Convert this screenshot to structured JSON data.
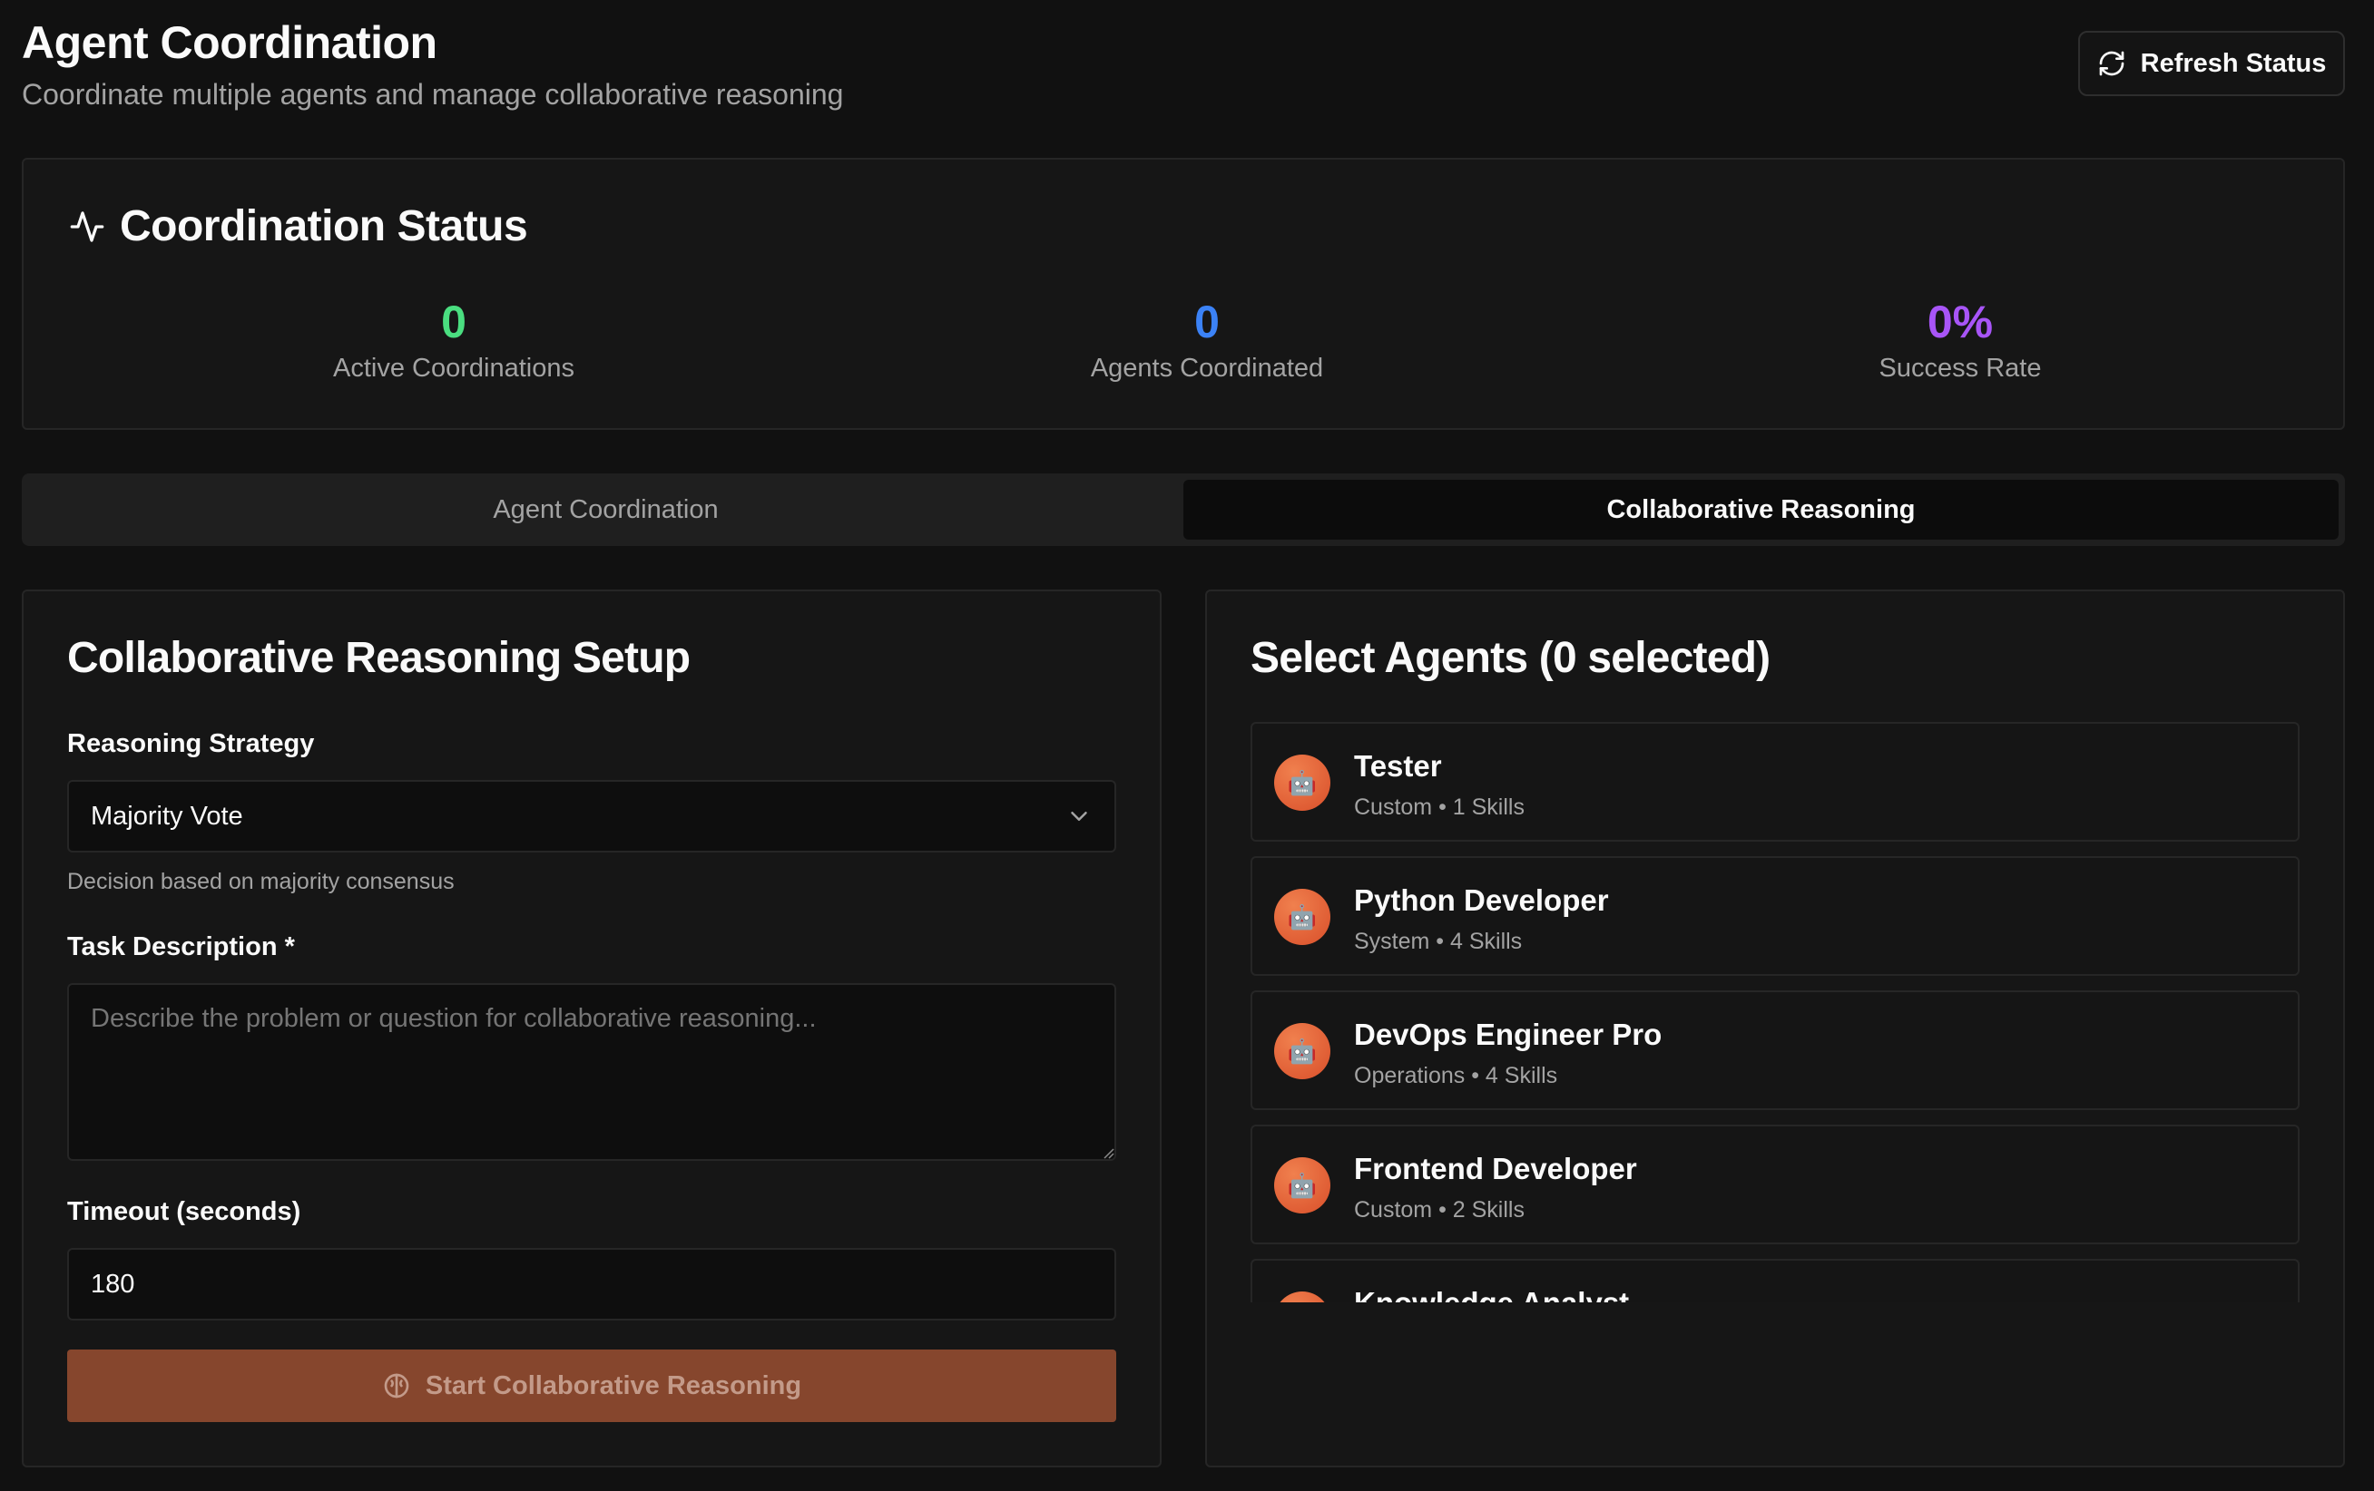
{
  "header": {
    "title": "Agent Coordination",
    "subtitle": "Coordinate multiple agents and manage collaborative reasoning",
    "refresh_label": "Refresh Status"
  },
  "status": {
    "title": "Coordination Status",
    "stats": [
      {
        "value": "0",
        "label": "Active Coordinations",
        "color": "#4ade80"
      },
      {
        "value": "0",
        "label": "Agents Coordinated",
        "color": "#3b82f6"
      },
      {
        "value": "0%",
        "label": "Success Rate",
        "color": "#a855f7"
      }
    ]
  },
  "tabs": [
    {
      "label": "Agent Coordination",
      "active": false
    },
    {
      "label": "Collaborative Reasoning",
      "active": true
    }
  ],
  "setup": {
    "title": "Collaborative Reasoning Setup",
    "strategy_label": "Reasoning Strategy",
    "strategy_value": "Majority Vote",
    "strategy_hint": "Decision based on majority consensus",
    "task_label": "Task Description *",
    "task_placeholder": "Describe the problem or question for collaborative reasoning...",
    "timeout_label": "Timeout (seconds)",
    "timeout_value": "180",
    "start_label": "Start Collaborative Reasoning"
  },
  "agents": {
    "title": "Select Agents (0 selected)",
    "items": [
      {
        "name": "Tester",
        "meta": "Custom • 1 Skills"
      },
      {
        "name": "Python Developer",
        "meta": "System • 4 Skills"
      },
      {
        "name": "DevOps Engineer Pro",
        "meta": "Operations • 4 Skills"
      },
      {
        "name": "Frontend Developer",
        "meta": "Custom • 2 Skills"
      },
      {
        "name": "Knowledge Analyst",
        "meta": ""
      }
    ]
  },
  "colors": {
    "accent": "#86462d",
    "avatar": "#e5643a"
  }
}
